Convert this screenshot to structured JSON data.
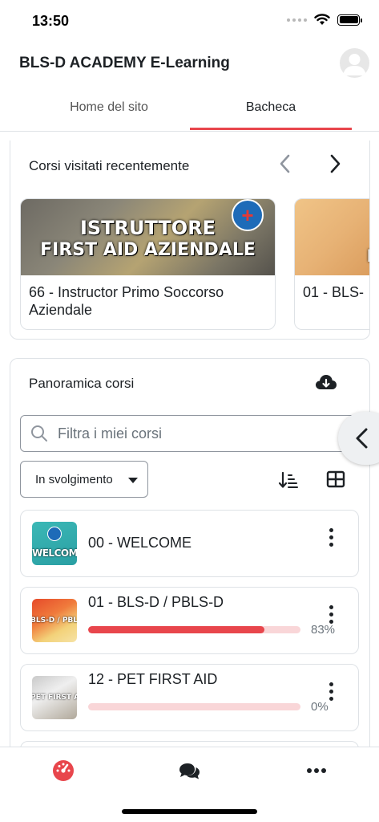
{
  "status_bar": {
    "time": "13:50"
  },
  "header": {
    "title": "BLS-D ACADEMY E-Learning",
    "avatar_icon": "user-avatar"
  },
  "tabs": [
    {
      "label": "Home del sito",
      "active": false
    },
    {
      "label": "Bacheca",
      "active": true
    }
  ],
  "recent": {
    "title": "Corsi visitati recentemente",
    "items": [
      {
        "name": "66 - Instructor Primo Soccorso Aziendale",
        "banner_line1": "ISTRUTTORE",
        "banner_line2": "FIRST AID AZIENDALE"
      },
      {
        "name": "01 - BLS-",
        "banner_letter": "B"
      }
    ]
  },
  "overview": {
    "title": "Panoramica corsi",
    "search_placeholder": "Filtra i miei corsi",
    "filter_value": "In svolgimento",
    "courses": [
      {
        "name": "00 - WELCOME",
        "thumb_label": "WELCOME",
        "progress": null
      },
      {
        "name": "01 - BLS-D / PBLS-D",
        "thumb_label": "BLS-D / PBLS-D",
        "progress": 83,
        "progress_label": "83%"
      },
      {
        "name": "12 - PET FIRST AID",
        "thumb_label": "PET FIRST AID",
        "progress": 0,
        "progress_label": "0%"
      }
    ]
  },
  "colors": {
    "accent": "#e8464c",
    "progress_track": "#f9d6d8",
    "welcome_thumb": "#3bb8b6"
  },
  "bottom_nav": [
    "dashboard-icon",
    "messages-icon",
    "more-icon"
  ]
}
